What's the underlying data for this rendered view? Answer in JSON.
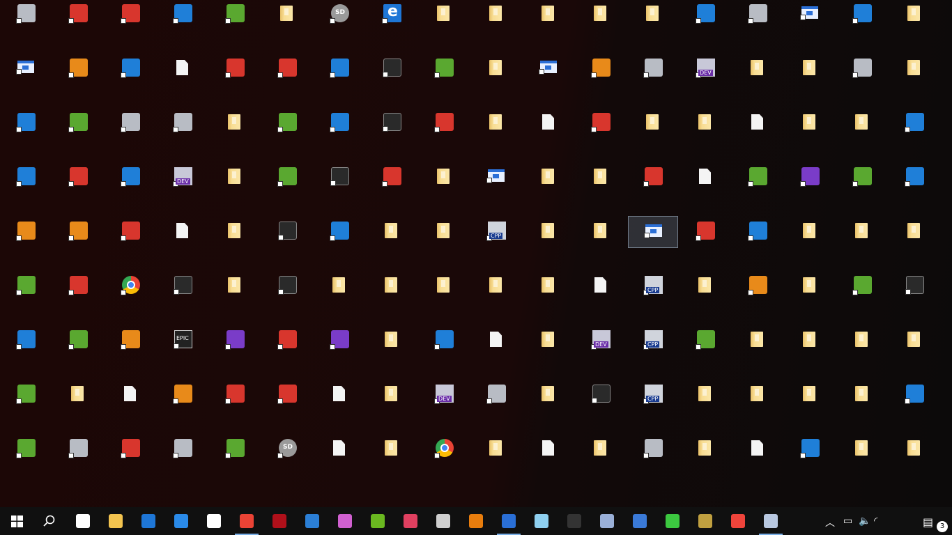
{
  "desktop": {
    "icons": [
      [
        "app",
        "app-red",
        "app-red",
        "app-blue",
        "app-green",
        "folder",
        "sd",
        "ie",
        "folder",
        "folder",
        "folder",
        "folder",
        "folder",
        "app-blue",
        "app-gray",
        "win",
        "app-blue",
        "folder"
      ],
      [
        "win",
        "app-orange",
        "app-blue",
        "file",
        "app-red",
        "app-red",
        "app-blue",
        "app-dark",
        "app-green",
        "folder",
        "win",
        "app-orange",
        "app-gray",
        "dev",
        "folder",
        "folder",
        "app-gray",
        "folder"
      ],
      [
        "app-blue",
        "app-green",
        "app-gray",
        "app-gray",
        "folder",
        "app-green",
        "app-blue",
        "app-dark",
        "app-red",
        "folder",
        "file",
        "app-red",
        "folder",
        "folder",
        "file",
        "folder",
        "folder",
        "app-blue"
      ],
      [
        "app-blue",
        "app-red",
        "app-blue",
        "dev",
        "folder",
        "app-green",
        "app-dark",
        "app-red",
        "folder",
        "win",
        "folder",
        "folder",
        "app-red",
        "file",
        "app-green",
        "app-purple",
        "app-green",
        "app-blue"
      ],
      [
        "app-orange",
        "app-orange",
        "app-red",
        "file",
        "folder",
        "app-dark",
        "app-blue",
        "folder",
        "folder",
        "cpp",
        "folder",
        "folder",
        "win",
        "app-red",
        "app-blue",
        "folder",
        "folder",
        "folder"
      ],
      [
        "app-green",
        "app-red",
        "chrome",
        "app-dark",
        "folder",
        "app-dark",
        "folder",
        "folder",
        "folder",
        "folder",
        "folder",
        "file",
        "cpp",
        "folder",
        "app-orange",
        "folder",
        "app-green",
        "app-dark"
      ],
      [
        "app-blue",
        "app-green",
        "app-orange",
        "epic",
        "app-purple",
        "app-red",
        "app-purple",
        "folder",
        "app-blue",
        "file",
        "folder",
        "dev",
        "cpp",
        "app-green",
        "folder",
        "folder",
        "folder",
        "folder"
      ],
      [
        "app-green",
        "folder",
        "file",
        "app-orange",
        "app-red",
        "app-red",
        "file",
        "folder",
        "dev",
        "app-gray",
        "folder",
        "app-dark",
        "cpp",
        "folder",
        "folder",
        "folder",
        "folder",
        "app-blue"
      ],
      [
        "app-green",
        "app-gray",
        "app-red",
        "app-gray",
        "app-green",
        "sd",
        "file",
        "folder",
        "chrome",
        "folder",
        "file",
        "folder",
        "app-gray",
        "folder",
        "file",
        "app-blue",
        "folder",
        "folder"
      ]
    ],
    "selected": {
      "row": 4,
      "col": 12
    }
  },
  "taskbar": {
    "start_label": "Start",
    "search_label": "Search",
    "items": [
      {
        "name": "task-view",
        "icon": "task-view-icon",
        "color": "#ffffff"
      },
      {
        "name": "file-explorer",
        "icon": "folder-icon",
        "color": "#f3c44f"
      },
      {
        "name": "edge",
        "icon": "edge-icon",
        "color": "#1e76d6"
      },
      {
        "name": "internet-explorer",
        "icon": "ie-icon",
        "color": "#2a8ae8"
      },
      {
        "name": "store",
        "icon": "store-icon",
        "color": "#ffffff"
      },
      {
        "name": "chrome",
        "icon": "chrome-icon",
        "color": "#ea4335",
        "running": true
      },
      {
        "name": "app-red-dots",
        "icon": "red-dots-icon",
        "color": "#b0101a"
      },
      {
        "name": "mail",
        "icon": "mail-icon",
        "color": "#2b7fd6"
      },
      {
        "name": "paint-3d",
        "icon": "paint-icon",
        "color": "#d060d0"
      },
      {
        "name": "green-e-app",
        "icon": "green-e-icon",
        "color": "#6ab820"
      },
      {
        "name": "paint-tool",
        "icon": "paint-tool-icon",
        "color": "#e04060"
      },
      {
        "name": "after-effects",
        "icon": "ae-icon",
        "color": "#cfcfcf"
      },
      {
        "name": "blender",
        "icon": "blender-icon",
        "color": "#e87d0d"
      },
      {
        "name": "devcpp",
        "icon": "dev-icon",
        "color": "#2a6fd6",
        "running": true
      },
      {
        "name": "tablet-app",
        "icon": "tablet-icon",
        "color": "#8fd0f0"
      },
      {
        "name": "mouse-app",
        "icon": "mouse-icon",
        "color": "#333333"
      },
      {
        "name": "image-editor",
        "icon": "image-edit-icon",
        "color": "#9ab0d8"
      },
      {
        "name": "eclipse-blue",
        "icon": "gear-blue-icon",
        "color": "#3a7ad8"
      },
      {
        "name": "mushroom-app",
        "icon": "mushroom-icon",
        "color": "#3cc840"
      },
      {
        "name": "pencil-app",
        "icon": "pencils-icon",
        "color": "#c0a040"
      },
      {
        "name": "anydesk",
        "icon": "anydesk-icon",
        "color": "#ef443b"
      },
      {
        "name": "control-panel",
        "icon": "control-panel-icon",
        "color": "#b8c8e0",
        "running": true
      }
    ],
    "tray": {
      "notification_count": "3"
    }
  }
}
